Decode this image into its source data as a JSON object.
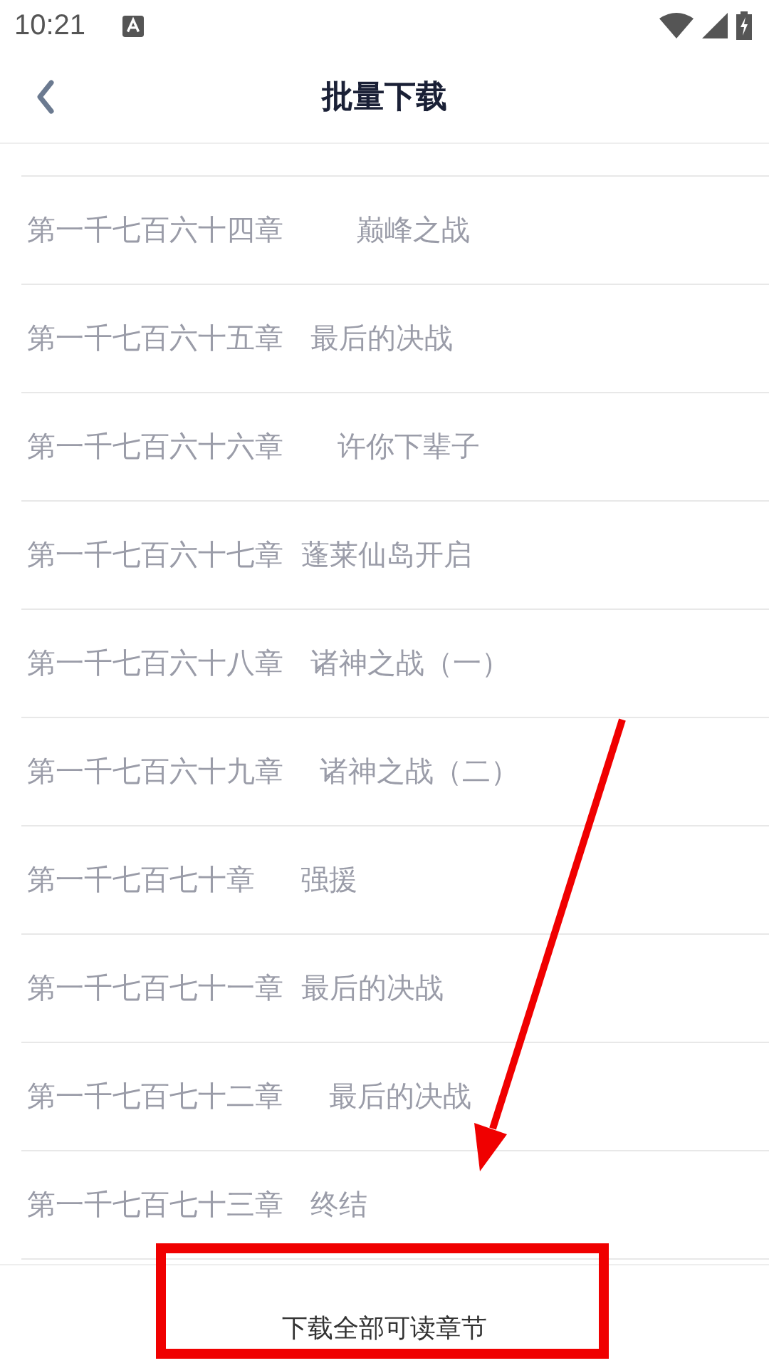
{
  "status_bar": {
    "time": "10:21"
  },
  "header": {
    "title": "批量下载"
  },
  "chapters": [
    {
      "title": "第一千七百六十四章        巅峰之战"
    },
    {
      "title": "第一千七百六十五章   最后的决战"
    },
    {
      "title": "第一千七百六十六章      许你下辈子"
    },
    {
      "title": "第一千七百六十七章  蓬莱仙岛开启"
    },
    {
      "title": "第一千七百六十八章   诸神之战（一）"
    },
    {
      "title": "第一千七百六十九章    诸神之战（二）"
    },
    {
      "title": "第一千七百七十章     强援"
    },
    {
      "title": "第一千七百七十一章  最后的决战"
    },
    {
      "title": "第一千七百七十二章     最后的决战"
    },
    {
      "title": "第一千七百七十三章   终结"
    }
  ],
  "download_button": {
    "label": "下载全部可读章节"
  }
}
